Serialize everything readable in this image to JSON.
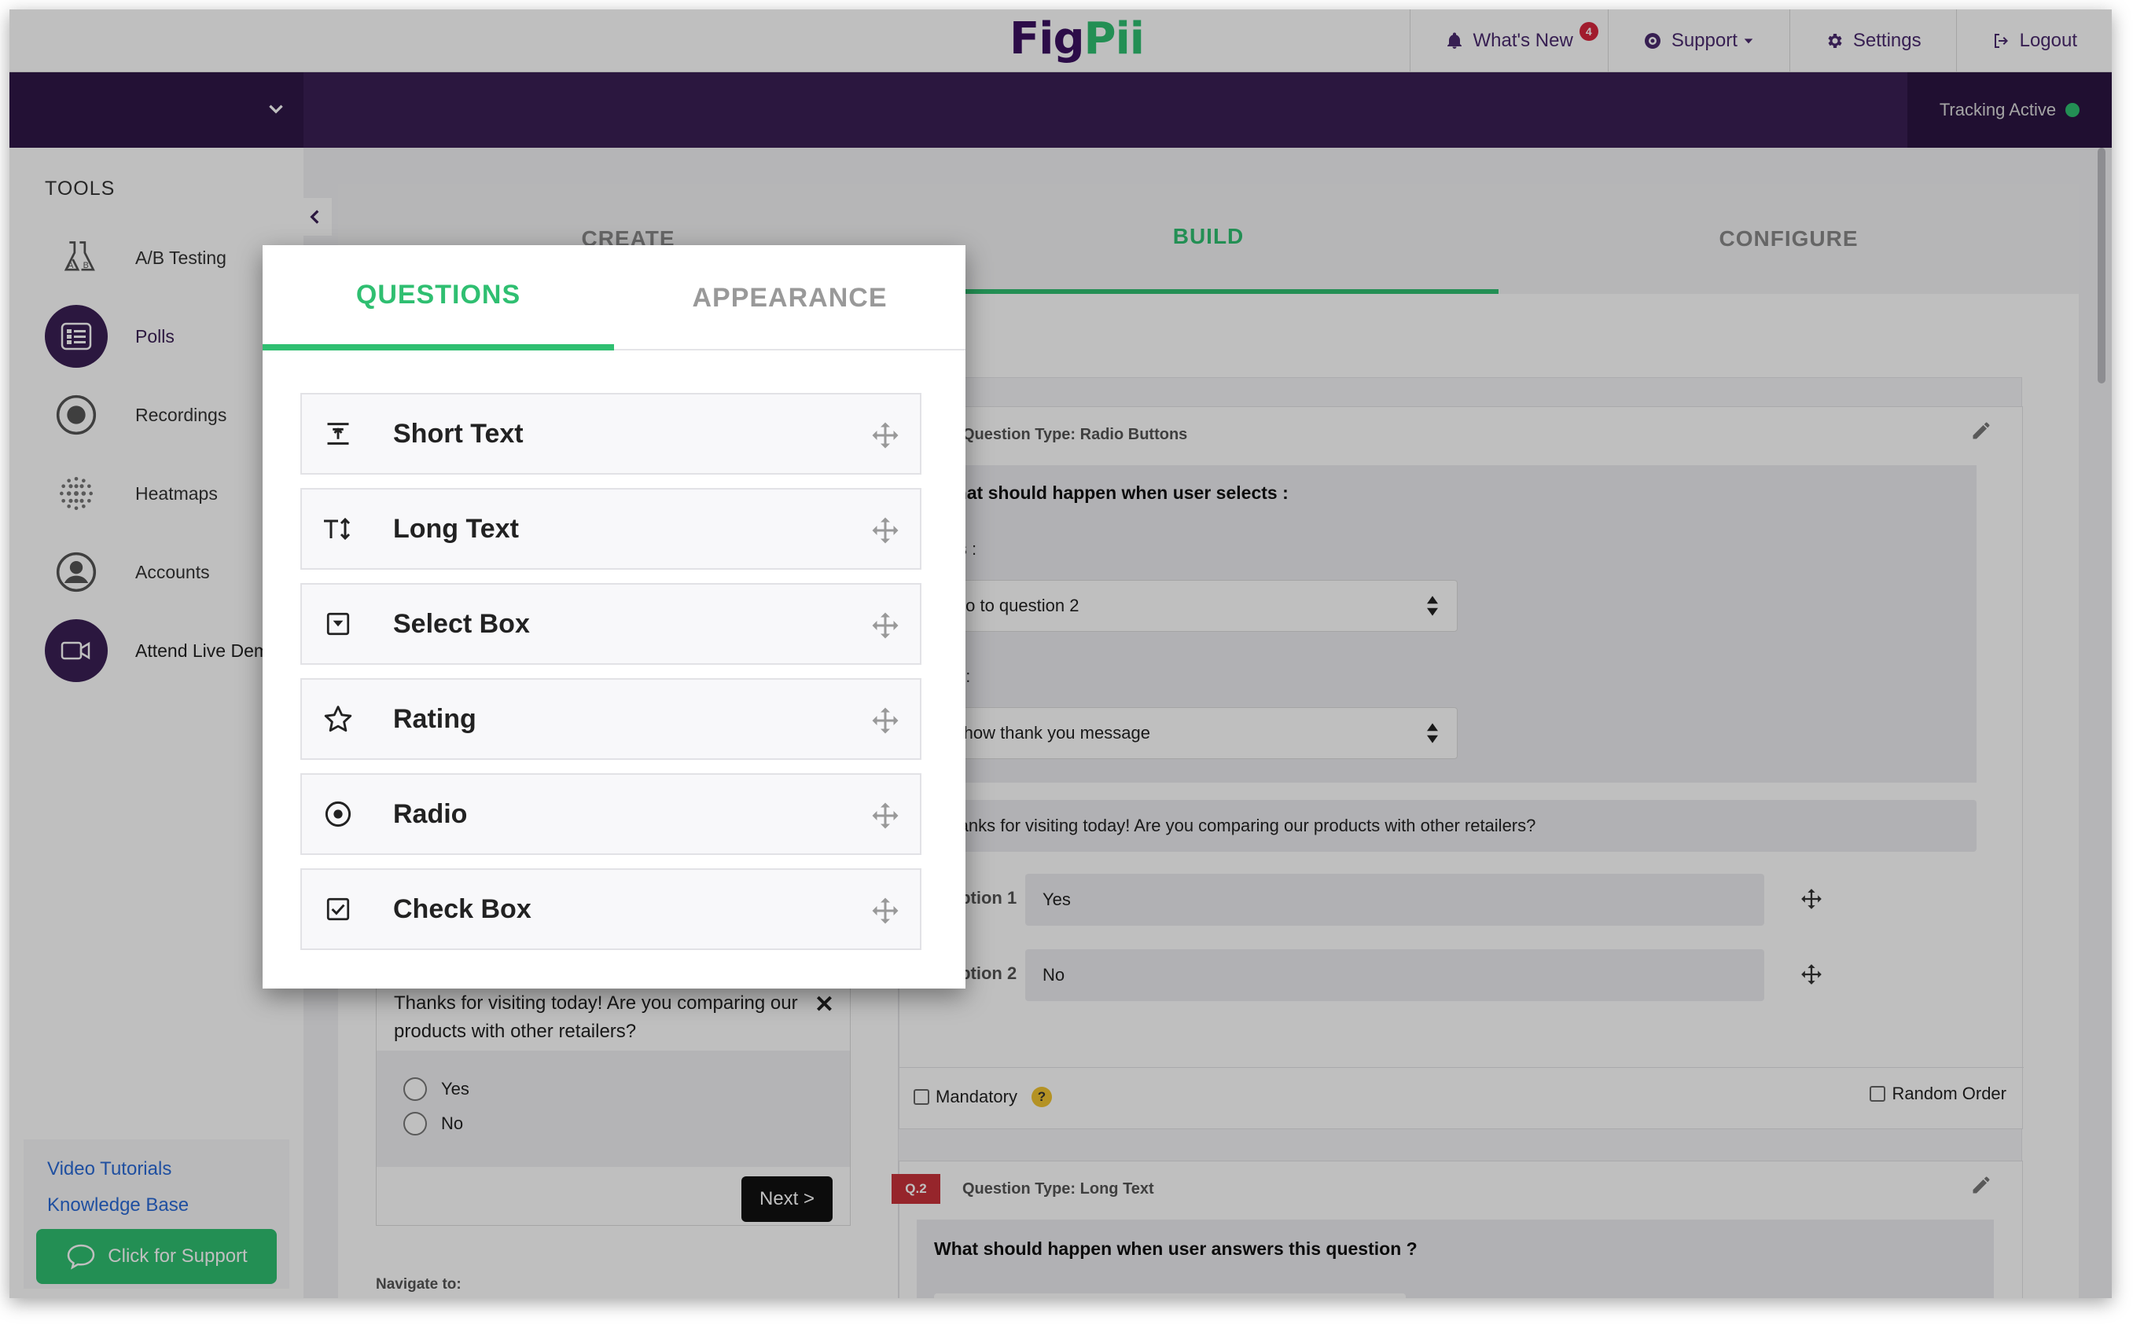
{
  "colors": {
    "brand_purple": "#3a1f55",
    "accent_green": "#2fbf71",
    "alert_red": "#d7263d"
  },
  "header": {
    "logo_part1": "Fig",
    "logo_part2": "Pii",
    "nav": {
      "whats_new": "What's New",
      "whats_new_count": "4",
      "support": "Support",
      "settings": "Settings",
      "logout": "Logout"
    }
  },
  "subheader": {
    "tracking": "Tracking Active"
  },
  "sidebar": {
    "title": "TOOLS",
    "items": [
      {
        "label": "A/B Testing",
        "icon": "flask-icon"
      },
      {
        "label": "Polls",
        "icon": "list-icon"
      },
      {
        "label": "Recordings",
        "icon": "record-icon"
      },
      {
        "label": "Heatmaps",
        "icon": "heatmap-icon"
      },
      {
        "label": "Accounts",
        "icon": "user-icon"
      },
      {
        "label": "Attend Live Demo",
        "icon": "video-icon"
      }
    ],
    "links": {
      "video_tutorials": "Video Tutorials",
      "knowledge_base": "Knowledge Base",
      "support_button": "Click for Support"
    }
  },
  "steps": {
    "create": "CREATE",
    "build": "BUILD",
    "configure": "CONFIGURE"
  },
  "preview": {
    "question": "Thanks for visiting today! Are you comparing our products with other retailers?",
    "options": [
      "Yes",
      "No"
    ],
    "next_button": "Next >",
    "navigate_label": "Navigate to:"
  },
  "question1": {
    "type_label": "Question Type: Radio Buttons",
    "logic_title": "What should happen when user selects :",
    "yes_label": "Yes :",
    "yes_action": "Go to question 2",
    "no_label": "No :",
    "no_action": "Show thank you message",
    "question_text": "Thanks for visiting today! Are you comparing our products with other retailers?",
    "option1_label": "Option 1",
    "option1_value": "Yes",
    "option2_label": "Option 2",
    "option2_value": "No",
    "mandatory": "Mandatory",
    "help": "?",
    "random_order": "Random Order"
  },
  "question2": {
    "badge": "Q.2",
    "type_label": "Question Type: Long Text",
    "logic_title": "What should happen when user answers this question ?"
  },
  "popup": {
    "tabs": {
      "questions": "QUESTIONS",
      "appearance": "APPEARANCE"
    },
    "items": [
      {
        "label": "Short Text",
        "icon": "short-text-icon"
      },
      {
        "label": "Long Text",
        "icon": "long-text-icon"
      },
      {
        "label": "Select Box",
        "icon": "select-box-icon"
      },
      {
        "label": "Rating",
        "icon": "star-icon"
      },
      {
        "label": "Radio",
        "icon": "radio-icon"
      },
      {
        "label": "Check Box",
        "icon": "checkbox-icon"
      }
    ]
  }
}
